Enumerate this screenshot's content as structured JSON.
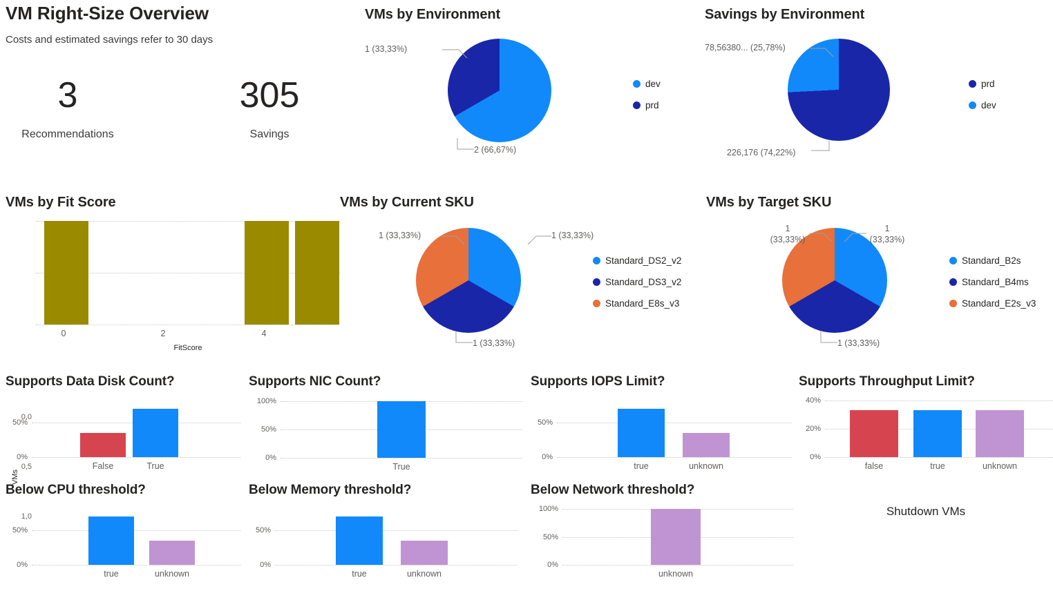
{
  "header": {
    "title": "VM Right-Size Overview",
    "subtitle": "Costs and estimated savings refer to 30 days"
  },
  "kpis": [
    {
      "value": "3",
      "label": "Recommendations"
    },
    {
      "value": "305",
      "label": "Savings"
    }
  ],
  "colors": {
    "light_blue": "#1189FB",
    "dark_blue": "#1A26A8",
    "orange": "#E8703A",
    "olive": "#998A00",
    "red": "#D6444F",
    "purple": "#C094D2",
    "grid": "#c8c6c4",
    "text": "#252423",
    "muted": "#605e5c"
  },
  "panels": {
    "vms_by_environment": "VMs by Environment",
    "savings_by_environment": "Savings by Environment",
    "vms_by_fit_score": "VMs by Fit Score",
    "vms_by_current_sku": "VMs by Current SKU",
    "vms_by_target_sku": "VMs by Target SKU",
    "supports_data_disk": "Supports Data Disk Count?",
    "supports_nic": "Supports NIC Count?",
    "supports_iops": "Supports IOPS Limit?",
    "supports_throughput": "Supports Throughput Limit?",
    "below_cpu": "Below CPU threshold?",
    "below_memory": "Below Memory threshold?",
    "below_network": "Below Network threshold?",
    "shutdown_vms": "Shutdown VMs"
  },
  "chart_data": [
    {
      "id": "vms_by_environment",
      "type": "pie",
      "title": "VMs by Environment",
      "legend_position": "right",
      "slices": [
        {
          "name": "dev",
          "value": 2,
          "percent": 66.67,
          "label": "2 (66,67%)",
          "color": "#1189FB"
        },
        {
          "name": "prd",
          "value": 1,
          "percent": 33.33,
          "label": "1 (33,33%)",
          "color": "#1A26A8"
        }
      ],
      "legend": [
        "dev",
        "prd"
      ]
    },
    {
      "id": "savings_by_environment",
      "type": "pie",
      "title": "Savings by Environment",
      "legend_position": "right",
      "slices": [
        {
          "name": "prd",
          "value": 226176,
          "percent": 74.22,
          "label": "226,176 (74,22%)",
          "color": "#1A26A8"
        },
        {
          "name": "dev",
          "value": 78.5638,
          "percent": 25.78,
          "label": "78,56380... (25,78%)",
          "color": "#1189FB"
        }
      ],
      "legend": [
        "prd",
        "dev"
      ]
    },
    {
      "id": "vms_by_fit_score",
      "type": "bar",
      "title": "VMs by Fit Score",
      "xlabel": "FitScore",
      "ylabel": "VMs",
      "ylim": [
        0,
        1
      ],
      "yticks": [
        "0,0",
        "0,5",
        "1,0"
      ],
      "xticks": [
        "0",
        "2",
        "4"
      ],
      "categories": [
        "0",
        "4",
        "5"
      ],
      "values": [
        1,
        1,
        1
      ],
      "bar_color": "#998A00",
      "grid": true
    },
    {
      "id": "vms_by_current_sku",
      "type": "pie",
      "title": "VMs by Current SKU",
      "legend_position": "right",
      "slices": [
        {
          "name": "Standard_DS2_v2",
          "value": 1,
          "percent": 33.33,
          "label": "1 (33,33%)",
          "color": "#1189FB"
        },
        {
          "name": "Standard_DS3_v2",
          "value": 1,
          "percent": 33.33,
          "label": "1 (33,33%)",
          "color": "#1A26A8"
        },
        {
          "name": "Standard_E8s_v3",
          "value": 1,
          "percent": 33.33,
          "label": "1 (33,33%)",
          "color": "#E8703A"
        }
      ],
      "legend": [
        "Standard_DS2_v2",
        "Standard_DS3_v2",
        "Standard_E8s_v3"
      ]
    },
    {
      "id": "vms_by_target_sku",
      "type": "pie",
      "title": "VMs by Target SKU",
      "legend_position": "right",
      "slices": [
        {
          "name": "Standard_B2s",
          "value": 1,
          "percent": 33.33,
          "label": "1 (33,33%)",
          "color": "#1189FB"
        },
        {
          "name": "Standard_B4ms",
          "value": 1,
          "percent": 33.33,
          "label": "1 (33,33%)",
          "color": "#1A26A8"
        },
        {
          "name": "Standard_E2s_v3",
          "value": 1,
          "percent": 33.33,
          "label": "1 (33,33%)",
          "color": "#E8703A"
        }
      ],
      "legend": [
        "Standard_B2s",
        "Standard_B4ms",
        "Standard_E2s_v3"
      ]
    },
    {
      "id": "supports_data_disk",
      "type": "bar",
      "title": "Supports Data Disk Count?",
      "ylim": [
        0,
        75
      ],
      "yticks": [
        "0%",
        "50%"
      ],
      "categories": [
        "False",
        "True"
      ],
      "values": [
        33.33,
        66.67
      ],
      "colors": [
        "#D6444F",
        "#1189FB"
      ],
      "grid": true
    },
    {
      "id": "supports_nic",
      "type": "bar",
      "title": "Supports NIC Count?",
      "ylim": [
        0,
        100
      ],
      "yticks": [
        "0%",
        "50%",
        "100%"
      ],
      "categories": [
        "True"
      ],
      "values": [
        100
      ],
      "colors": [
        "#1189FB"
      ],
      "grid": true
    },
    {
      "id": "supports_iops",
      "type": "bar",
      "title": "Supports IOPS Limit?",
      "ylim": [
        0,
        75
      ],
      "yticks": [
        "0%",
        "50%"
      ],
      "categories": [
        "true",
        "unknown"
      ],
      "values": [
        66.67,
        33.33
      ],
      "colors": [
        "#1189FB",
        "#C094D2"
      ],
      "grid": true
    },
    {
      "id": "supports_throughput",
      "type": "bar",
      "title": "Supports Throughput Limit?",
      "ylim": [
        0,
        40
      ],
      "yticks": [
        "0%",
        "20%",
        "40%"
      ],
      "categories": [
        "false",
        "true",
        "unknown"
      ],
      "values": [
        33.33,
        33.33,
        33.33
      ],
      "colors": [
        "#D6444F",
        "#1189FB",
        "#C094D2"
      ],
      "grid": true
    },
    {
      "id": "below_cpu",
      "type": "bar",
      "title": "Below CPU threshold?",
      "ylim": [
        0,
        75
      ],
      "yticks": [
        "0%",
        "50%"
      ],
      "categories": [
        "true",
        "unknown"
      ],
      "values": [
        66.67,
        33.33
      ],
      "colors": [
        "#1189FB",
        "#C094D2"
      ],
      "grid": true
    },
    {
      "id": "below_memory",
      "type": "bar",
      "title": "Below Memory threshold?",
      "ylim": [
        0,
        75
      ],
      "yticks": [
        "0%",
        "50%"
      ],
      "categories": [
        "true",
        "unknown"
      ],
      "values": [
        66.67,
        33.33
      ],
      "colors": [
        "#1189FB",
        "#C094D2"
      ],
      "grid": true
    },
    {
      "id": "below_network",
      "type": "bar",
      "title": "Below Network threshold?",
      "ylim": [
        0,
        100
      ],
      "yticks": [
        "0%",
        "50%",
        "100%"
      ],
      "categories": [
        "unknown"
      ],
      "values": [
        100
      ],
      "colors": [
        "#C094D2"
      ],
      "grid": true
    }
  ]
}
